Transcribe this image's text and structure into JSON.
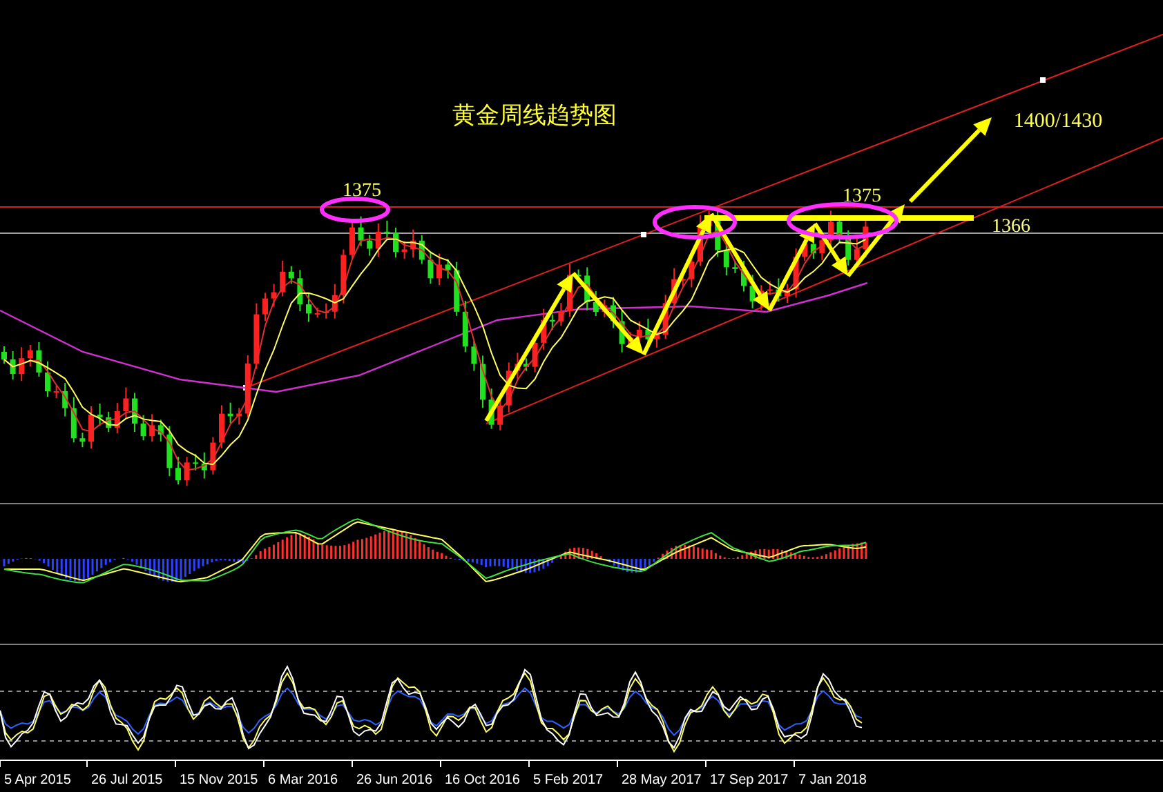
{
  "chart": {
    "title": "黄金周线趋势图",
    "annotations": [
      {
        "kind": "peak",
        "text": "1375"
      },
      {
        "kind": "peak",
        "text": "1375"
      },
      {
        "kind": "level",
        "text": "1366"
      },
      {
        "kind": "target",
        "text": "1400/1430"
      }
    ]
  },
  "x_axis": {
    "labels": [
      "5 Apr 2015",
      "26 Jul 2015",
      "15 Nov 2015",
      "6 Mar 2016",
      "26 Jun 2016",
      "16 Oct 2016",
      "5 Feb 2017",
      "28 May 2017",
      "17 Sep 2017",
      "7 Jan 2018"
    ]
  }
}
